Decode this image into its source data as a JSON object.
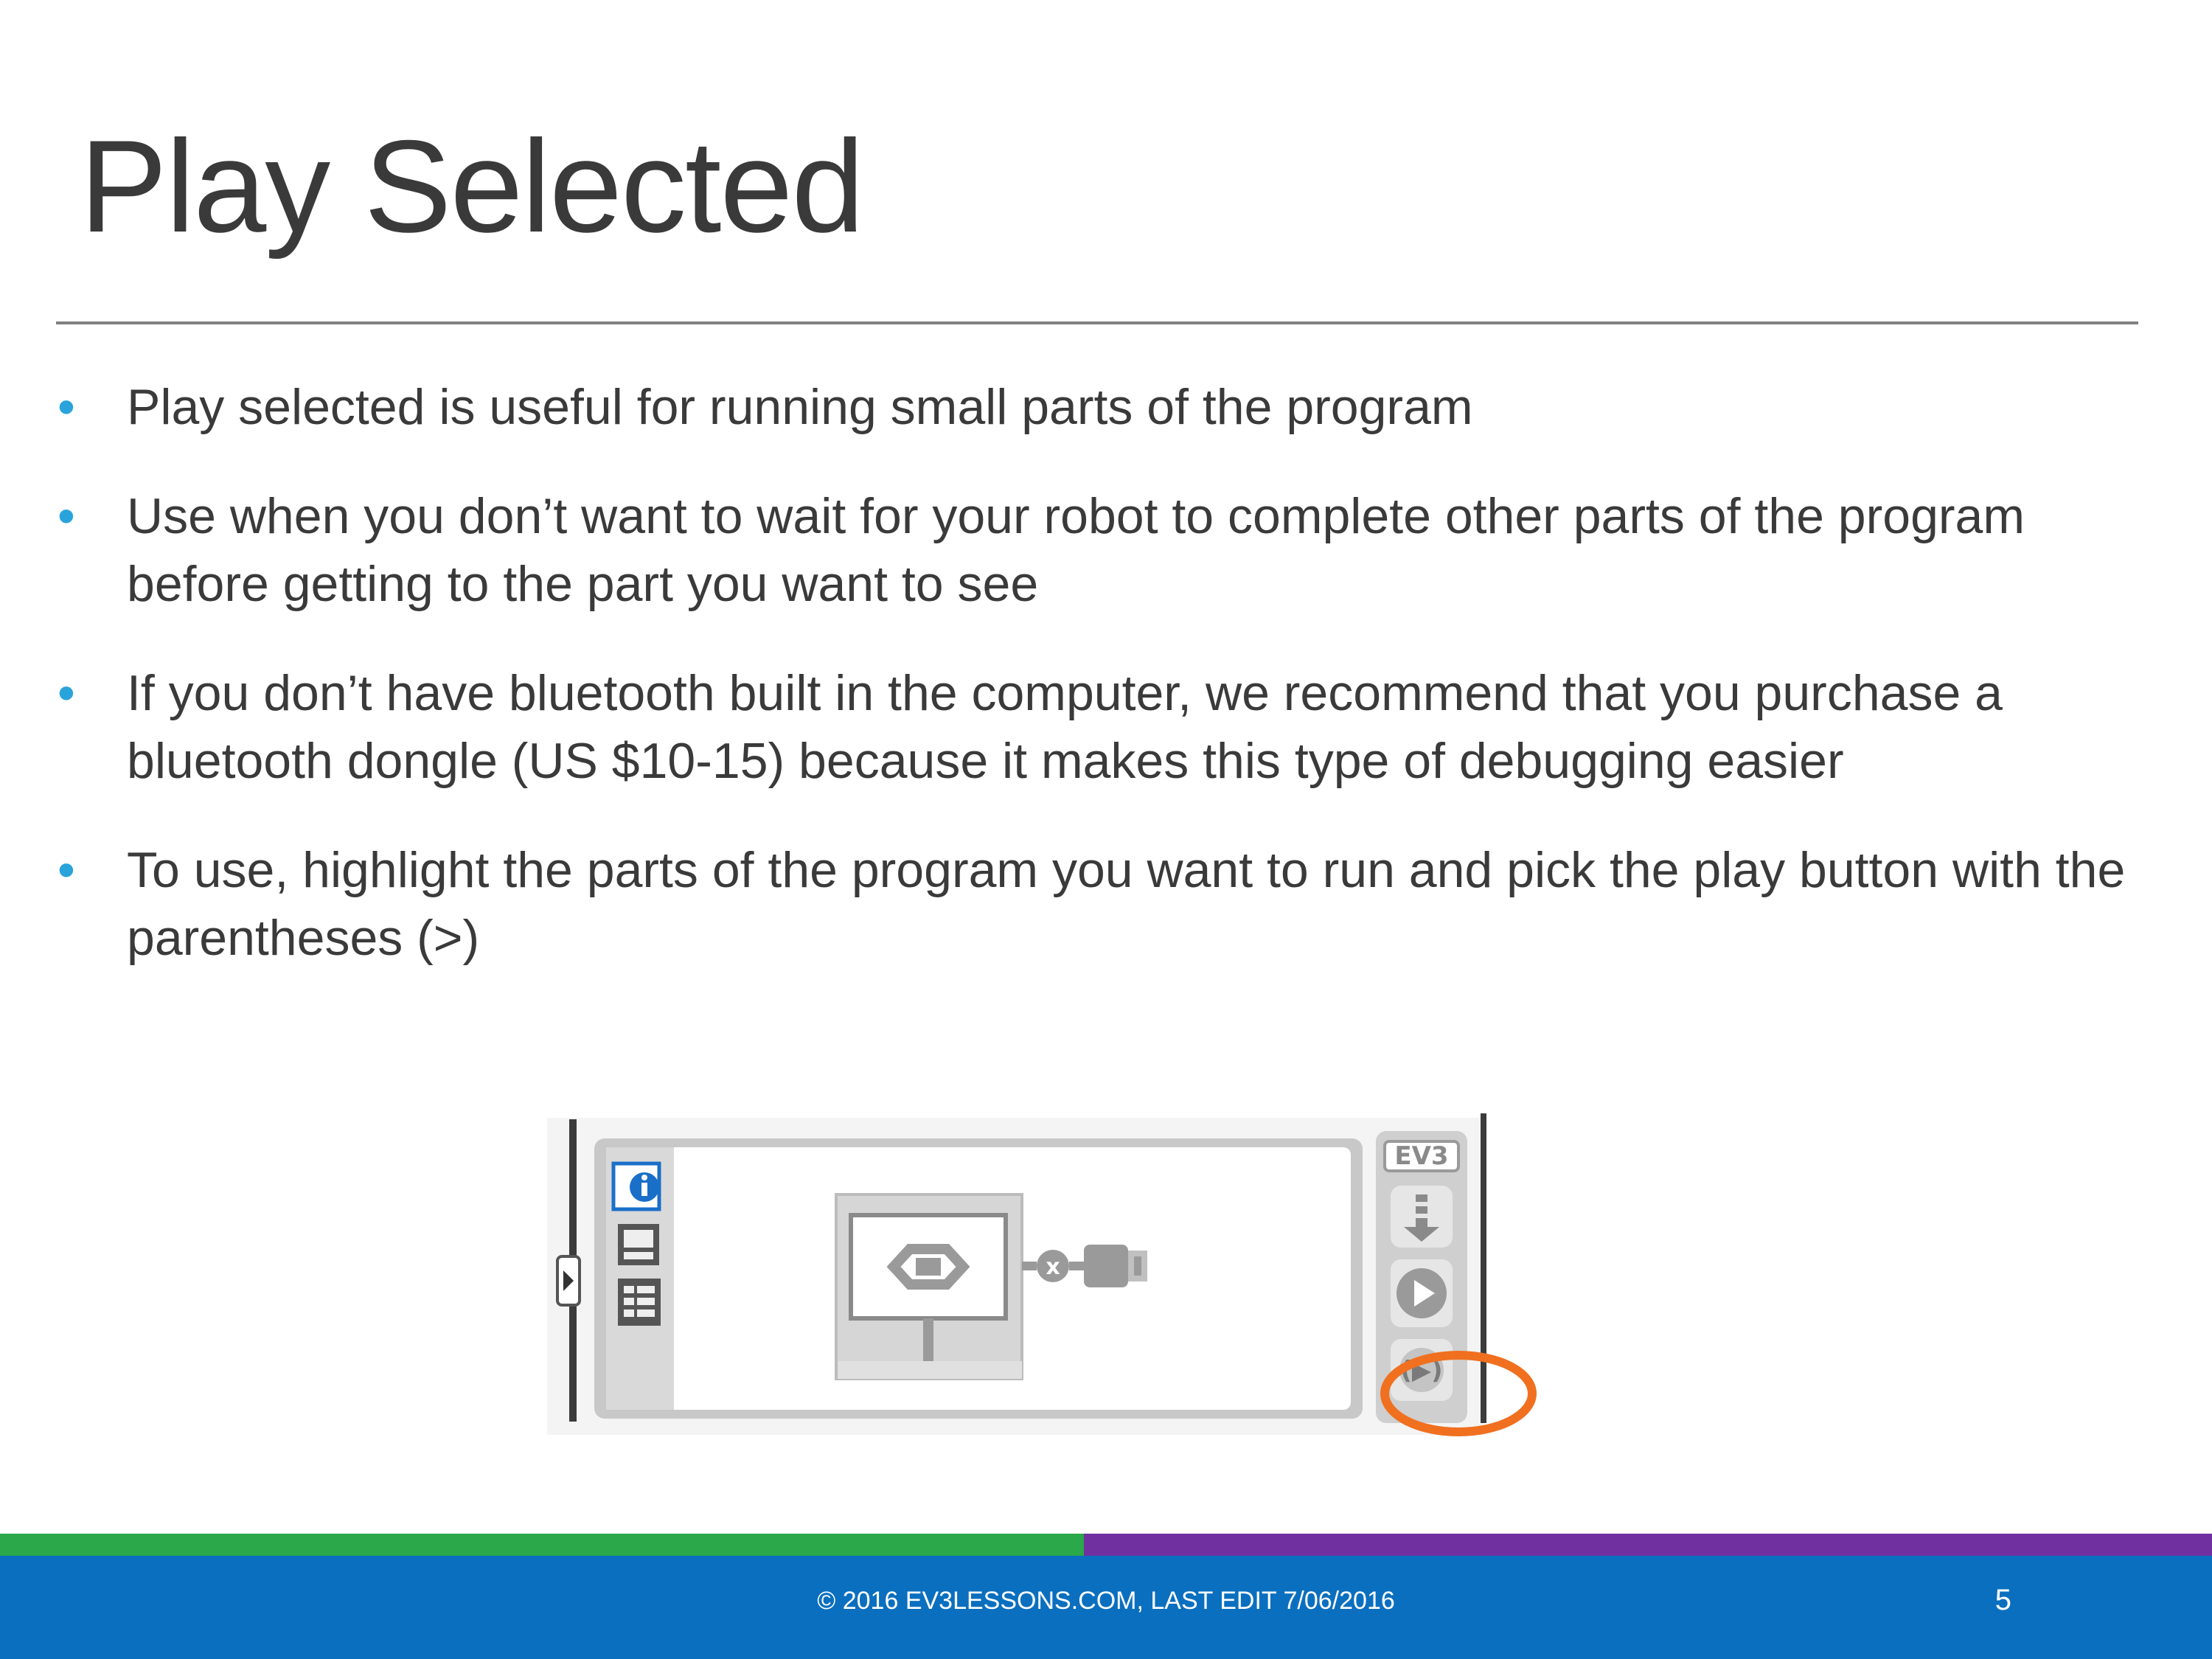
{
  "slide": {
    "title": "Play Selected",
    "bullets": [
      "Play selected is useful for running small parts of the program",
      "Use when you don’t want to wait for your robot to complete other parts of the program before getting to the part you want to see",
      "If you don’t have bluetooth built in the computer, we recommend that you purchase a bluetooth dongle (US $10-15)  because it makes this type of debugging easier",
      "To use, highlight the parts of the program you want to run and pick the play button with the parentheses (>)"
    ],
    "bullet_glyph": "•"
  },
  "screenshot": {
    "ev3_label": "EV3",
    "icons": [
      "info-icon",
      "brick-icon",
      "list-icon",
      "download-icon",
      "play-icon",
      "play-selected-icon",
      "start-block-icon",
      "motor-block-icon"
    ],
    "highlight_color": "#f07020"
  },
  "footer": {
    "copyright": "© 2016 EV3LESSONS.COM, LAST EDIT 7/06/2016",
    "page_number": "5"
  },
  "colors": {
    "bullet": "#29a3dc",
    "footer_bar": "#0b6fbf",
    "strip_green": "#2aa84a",
    "strip_purple": "#7030a0"
  }
}
